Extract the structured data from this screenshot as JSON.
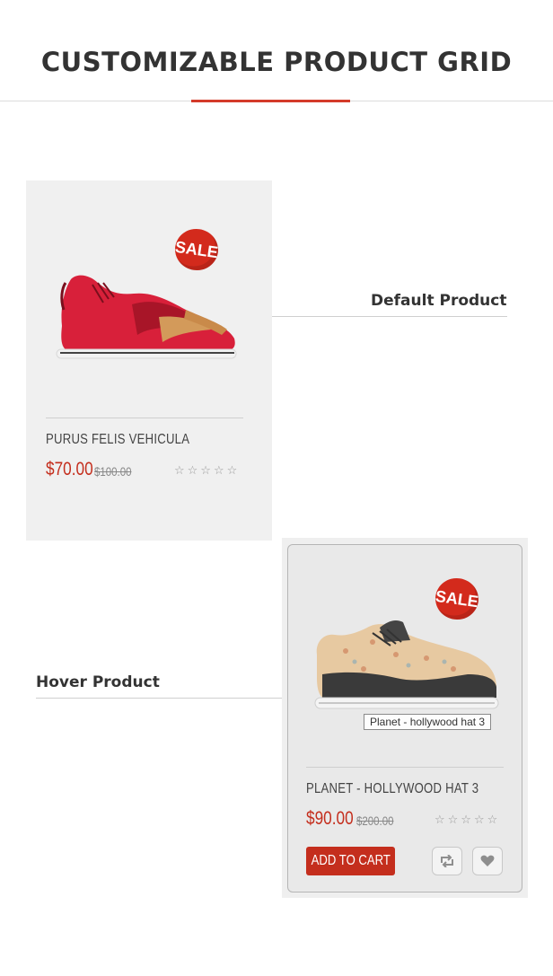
{
  "page": {
    "title": "CUSTOMIZABLE PRODUCT GRID"
  },
  "sections": {
    "default_label": "Default Product",
    "hover_label": "Hover Product"
  },
  "default_product": {
    "badge": "SALE",
    "name": "PURUS FELIS VEHICULA",
    "price": "$70.00",
    "old_price": "$100.00",
    "rating": "☆☆☆☆☆",
    "rating_value": 0,
    "image_icon": "red-sneaker-image"
  },
  "hover_product": {
    "badge": "SALE",
    "name": "PLANET - HOLLYWOOD HAT 3",
    "tooltip": "Planet - hollywood hat 3",
    "price": "$90.00",
    "old_price": "$200.00",
    "rating": "☆☆☆☆☆",
    "rating_value": 0,
    "add_to_cart": "ADD TO CART",
    "compare_icon": "refresh-icon",
    "wishlist_icon": "heart-icon",
    "image_icon": "tan-sneaker-image"
  },
  "colors": {
    "accent": "#c42e1d",
    "card_bg": "#f0f0f0"
  }
}
